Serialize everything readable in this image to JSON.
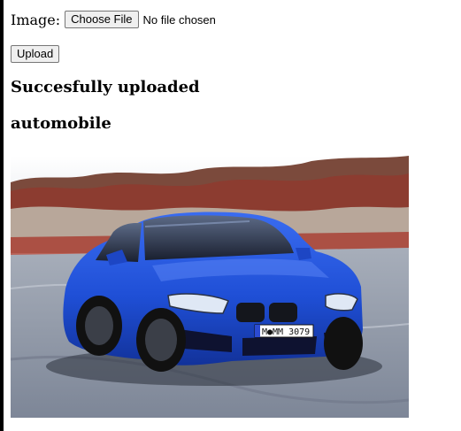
{
  "form": {
    "image_label": "Image:",
    "choose_file_label": "Choose File",
    "file_status": "No file chosen",
    "upload_label": "Upload"
  },
  "result": {
    "status_message": "Succesfully uploaded",
    "predicted_class": "automobile"
  },
  "image": {
    "plate_text": "M●MM 3079",
    "colors": {
      "car_body": "#1f4fd6",
      "sky": "#f4f4f7",
      "foliage": "#8f3a2e",
      "track": "#8e97a8"
    }
  }
}
